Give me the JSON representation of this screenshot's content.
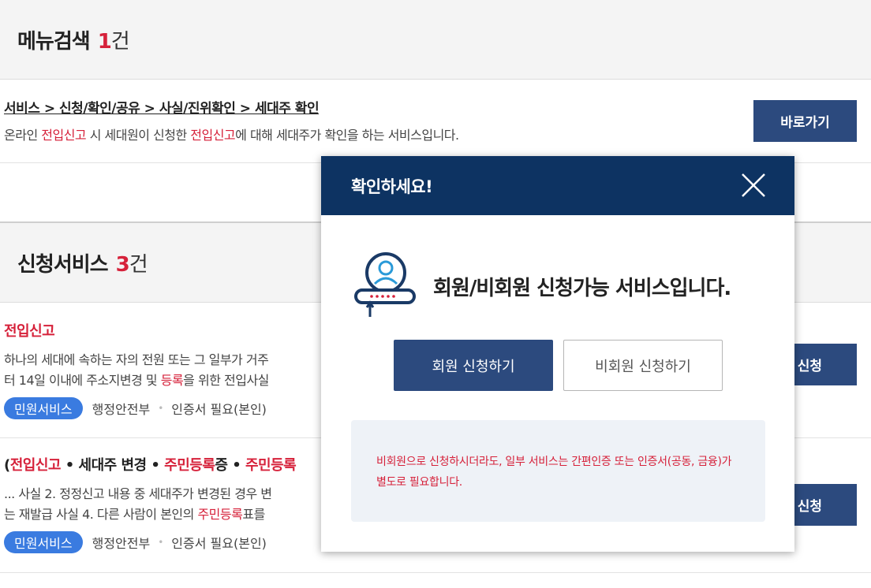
{
  "menu_search": {
    "title": "메뉴검색",
    "count": "1",
    "unit": "건"
  },
  "menu_result": {
    "path": "서비스 > 신청/확인/공유 > 사실/진위확인 > 세대주 확인",
    "desc_before": "온라인 ",
    "desc_hl1": "전입신고",
    "desc_mid": " 시 세대원이 신청한 ",
    "desc_hl2": "전입신고",
    "desc_after": "에 대해 세대주가 확인을 하는 서비스입니다.",
    "button": "바로가기"
  },
  "apply_services": {
    "title": "신청서비스",
    "count": "3",
    "unit": "건"
  },
  "service1": {
    "title": "전입신고",
    "line1": "하나의 세대에 속하는 자의 전원 또는 그 일부가 거주",
    "line2_before": "터 14일 이내에 주소지변경 및 ",
    "line2_hl": "등록",
    "line2_after": "을 위한 전입사실",
    "badge": "민원서비스",
    "agency": "행정안전부",
    "cert": "인증서 필요(본인)",
    "button": "신청"
  },
  "service2": {
    "title_paren": "(",
    "title_hl1": "전입신고",
    "title_sep1": " • 세대주 변경 • ",
    "title_hl2": "주민등록",
    "title_mid": "증 • ",
    "title_hl3": "주민등록",
    "line1": "... 사실 2. 정정신고 내용 중 세대주가 변경된 경우 변",
    "line2_before": "는 재발급 사실 4. 다른 사람이 본인의 ",
    "line2_hl": "주민등록",
    "line2_after": "표를",
    "badge": "민원서비스",
    "agency": "행정안전부",
    "cert": "인증서 필요(본인)",
    "button": "신청"
  },
  "modal": {
    "title": "확인하세요!",
    "message": "회원/비회원 신청가능 서비스입니다.",
    "member_button": "회원 신청하기",
    "nonmember_button": "비회원 신청하기",
    "notice": "비회원으로 신청하시더라도, 일부 서비스는 간편인증 또는 인증서(공동, 금융)가 별도로 필요합니다."
  },
  "colors": {
    "navy": "#0d3362",
    "button": "#2c4a7e",
    "highlight": "#d6213a",
    "badge": "#3a7be0"
  }
}
